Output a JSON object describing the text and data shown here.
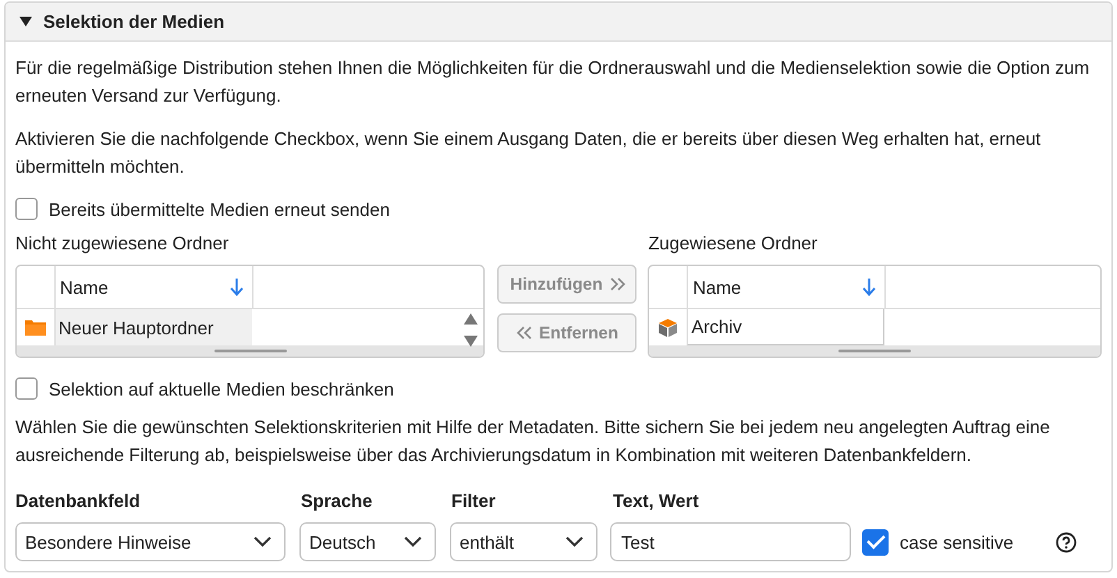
{
  "panel": {
    "title": "Selektion der Medien",
    "expanded": true
  },
  "intro": "Für die regelmäßige Distribution stehen Ihnen die Möglichkeiten für die Ordnerauswahl und die Medienselektion sowie die Option zum erneuten Versand zur Verfügung.",
  "hint": "Aktivieren Sie die nachfolgende Checkbox, wenn Sie einem Ausgang Daten, die er bereits über diesen Weg erhalten hat, erneut übermitteln möchten.",
  "resend": {
    "label": "Bereits übermittelte Medien erneut senden",
    "checked": false
  },
  "unassigned": {
    "title": "Nicht zugewiesene Ordner",
    "column": "Name",
    "rows": [
      {
        "kind": "folder",
        "name": "Neuer Hauptordner"
      }
    ]
  },
  "buttons": [
    {
      "kind": "add",
      "label": "Hinzufügen",
      "disabled": true
    },
    {
      "kind": "remove",
      "label": "Entfernen",
      "disabled": true
    }
  ],
  "assigned": {
    "title": "Zugewiesene Ordner",
    "column": "Name",
    "rows": [
      {
        "kind": "archive",
        "name": "Archiv"
      }
    ]
  },
  "restrict": {
    "label": "Selektion auf aktuelle Medien beschränken",
    "checked": false
  },
  "criteria_hint": "Wählen Sie die gewünschten Selektionskriterien mit Hilfe der Metadaten. Bitte sichern Sie bei jedem neu angelegten Auftrag eine ausreichende Filterung ab, beispielsweise über das Archivierungsdatum in Kombination mit weiteren Datenbankfeldern.",
  "criteria": {
    "field_label": "Datenbankfeld",
    "field": "Besondere Hinweise",
    "language_label": "Sprache",
    "language": "Deutsch",
    "filter_label": "Filter",
    "filter": "enthält",
    "value_label": "Text, Wert",
    "value": "Test",
    "case_sensitive": {
      "label": "case sensitive",
      "checked": true
    }
  }
}
